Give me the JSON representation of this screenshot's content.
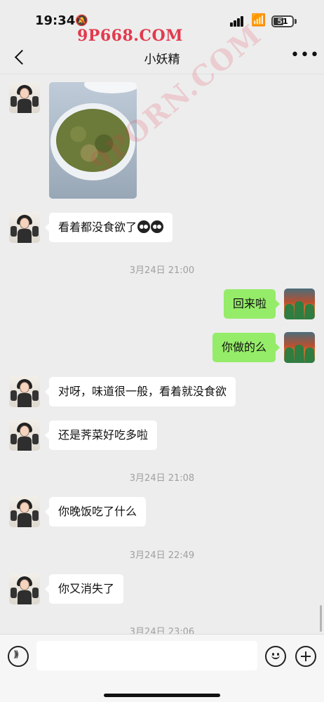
{
  "status_bar": {
    "time": "19:34",
    "battery_level": "51",
    "icons": [
      "bell-slash-icon",
      "cellular-signal-icon",
      "wifi-icon",
      "battery-icon"
    ]
  },
  "watermarks": {
    "top": "9P668.COM",
    "diagonal": "9PORN.COM"
  },
  "nav": {
    "title": "小妖精",
    "back_icon": "chevron-left-icon",
    "more_icon": "more-dots-icon"
  },
  "messages": [
    {
      "from": "her",
      "type": "image",
      "image": "fried-vegetable-dish-photo"
    },
    {
      "from": "her",
      "type": "text",
      "text": "看着都没食欲了",
      "emoji_count": 2
    },
    {
      "type": "timestamp",
      "text": "3月24日 21:00"
    },
    {
      "from": "me",
      "type": "text",
      "text": "回来啦"
    },
    {
      "from": "me",
      "type": "text",
      "text": "你做的么"
    },
    {
      "from": "her",
      "type": "text",
      "text": "对呀，味道很一般，看着就没食欲"
    },
    {
      "from": "her",
      "type": "text",
      "text": "还是荠菜好吃多啦"
    },
    {
      "type": "timestamp",
      "text": "3月24日 21:08"
    },
    {
      "from": "her",
      "type": "text",
      "text": "你晚饭吃了什么"
    },
    {
      "type": "timestamp",
      "text": "3月24日 22:49"
    },
    {
      "from": "her",
      "type": "text",
      "text": "你又消失了"
    },
    {
      "type": "timestamp",
      "text": "3月24日 23:06"
    }
  ],
  "input_bar": {
    "value": "",
    "icons": [
      "voice-icon",
      "emoji-icon",
      "plus-icon"
    ]
  },
  "colors": {
    "background": "#ededed",
    "incoming_bubble": "#ffffff",
    "outgoing_bubble": "#95ec69",
    "timestamp": "#a0a0a0",
    "watermark": "#e23a4d"
  }
}
